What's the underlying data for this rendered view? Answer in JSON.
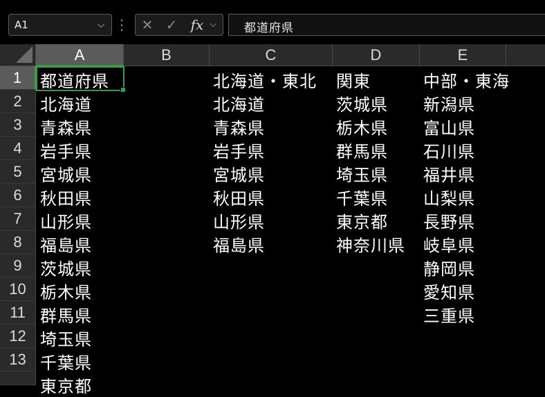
{
  "name_box": {
    "value": "A1"
  },
  "formula_bar": {
    "cancel_glyph": "✕",
    "enter_glyph": "✓",
    "fx_label": "fx",
    "content": "都道府県"
  },
  "columns": [
    "A",
    "B",
    "C",
    "D",
    "E"
  ],
  "rows": [
    "1",
    "2",
    "3",
    "4",
    "5",
    "6",
    "7",
    "8",
    "9",
    "10",
    "11",
    "12",
    "13"
  ],
  "cells": {
    "A": [
      "都道府県",
      "北海道",
      "青森県",
      "岩手県",
      "宮城県",
      "秋田県",
      "山形県",
      "福島県",
      "茨城県",
      "栃木県",
      "群馬県",
      "埼玉県",
      "千葉県",
      "東京都"
    ],
    "C": [
      "北海道・東北",
      "北海道",
      "青森県",
      "岩手県",
      "宮城県",
      "秋田県",
      "山形県",
      "福島県"
    ],
    "D": [
      "関東",
      "茨城県",
      "栃木県",
      "群馬県",
      "埼玉県",
      "千葉県",
      "東京都",
      "神奈川県"
    ],
    "E": [
      "中部・東海",
      "新潟県",
      "富山県",
      "石川県",
      "福井県",
      "山梨県",
      "長野県",
      "岐阜県",
      "静岡県",
      "愛知県",
      "三重県"
    ]
  },
  "colors": {
    "selection": "#3a9b4e",
    "header_bg": "#2a2a2a",
    "sheet_bg": "#000000"
  }
}
